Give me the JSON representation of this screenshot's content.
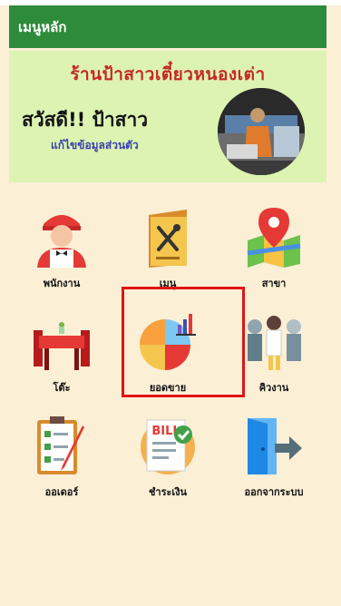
{
  "appbar": {
    "title": "เมนูหลัก"
  },
  "header": {
    "shop_name": "ร้านป้าสาวเตี๋ยวหนองเต่า",
    "greeting": "สวัสดี!! ป้าสาว",
    "edit_profile": "แก้ไขข้อมูลส่วนตัว"
  },
  "menu": {
    "items": [
      {
        "label": "พนักงาน",
        "icon": "employee-icon"
      },
      {
        "label": "เมนู",
        "icon": "food-menu-icon"
      },
      {
        "label": "สาขา",
        "icon": "branch-map-icon"
      },
      {
        "label": "โต๊ะ",
        "icon": "table-icon"
      },
      {
        "label": "ยอดขาย",
        "icon": "sales-chart-icon"
      },
      {
        "label": "คิวงาน",
        "icon": "queue-icon"
      },
      {
        "label": "ออเดอร์",
        "icon": "order-checklist-icon"
      },
      {
        "label": "ชำระเงิน",
        "icon": "bill-payment-icon"
      },
      {
        "label": "ออกจากระบบ",
        "icon": "logout-icon"
      }
    ]
  },
  "colors": {
    "appbar": "#2e8b3c",
    "header_bg": "#dcf3b2",
    "page_bg": "#fbefd6",
    "shop_name": "#c62828",
    "highlight": "#e01515"
  }
}
